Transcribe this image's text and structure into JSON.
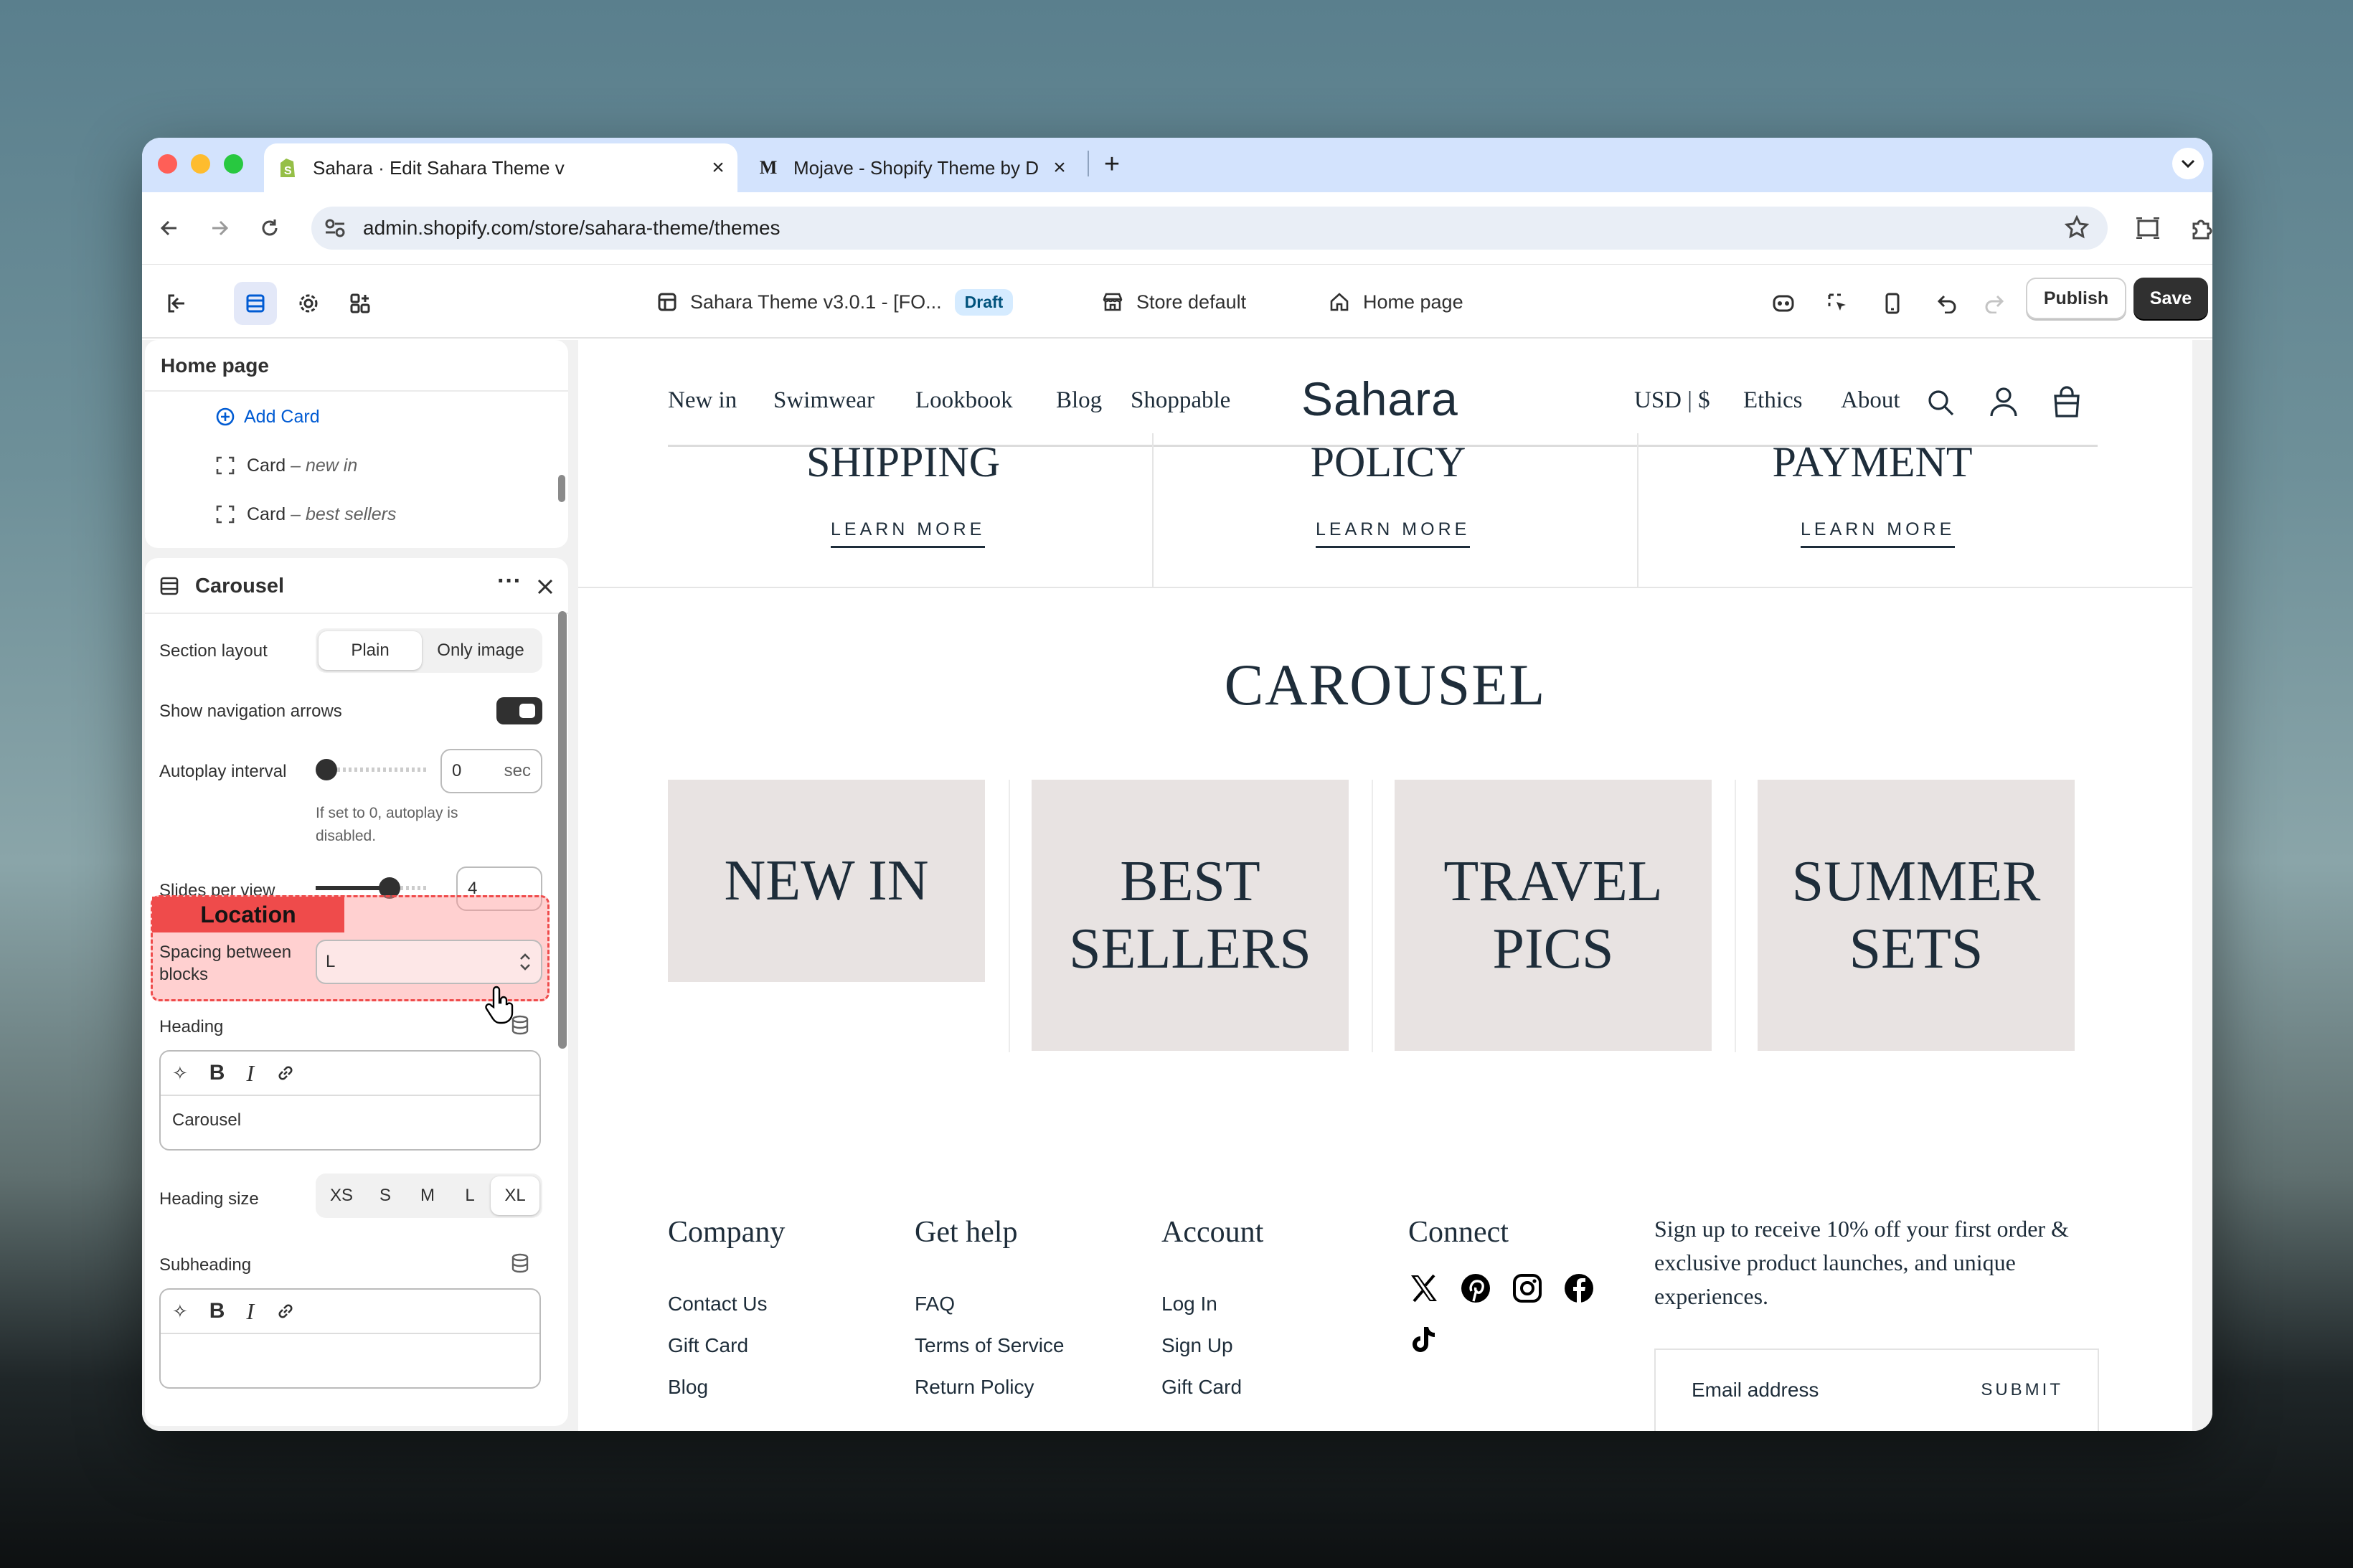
{
  "browser": {
    "tabs": [
      {
        "title": "Sahara · Edit Sahara Theme v",
        "favicon": "shopify-icon"
      },
      {
        "title": "Mojave - Shopify Theme by D",
        "favicon_letter": "M"
      }
    ],
    "url": "admin.shopify.com/store/sahara-theme/themes"
  },
  "app": {
    "theme_name": "Sahara Theme v3.0.1 - [FO...",
    "status_badge": "Draft",
    "store_selector": "Store default",
    "page_selector": "Home page",
    "publish_label": "Publish",
    "save_label": "Save"
  },
  "sidebar": {
    "header": "Home page",
    "add_card": "Add Card",
    "cards": [
      {
        "prefix": "Card",
        "name": "– new in"
      },
      {
        "prefix": "Card",
        "name": "– best sellers"
      }
    ]
  },
  "settings": {
    "title": "Carousel",
    "section_layout": {
      "label": "Section layout",
      "options": [
        "Plain",
        "Only image"
      ],
      "selected": "Plain"
    },
    "show_arrows": {
      "label": "Show navigation arrows",
      "value": true
    },
    "autoplay": {
      "label": "Autoplay interval",
      "value": "0",
      "unit": "sec",
      "help": "If set to 0, autoplay is disabled."
    },
    "slides_per_view": {
      "label": "Slides per view",
      "value": "4"
    },
    "tooltip": "Location",
    "spacing": {
      "label": "Spacing between blocks",
      "value": "L"
    },
    "heading": {
      "label": "Heading",
      "value": "Carousel"
    },
    "heading_size": {
      "label": "Heading size",
      "options": [
        "XS",
        "S",
        "M",
        "L",
        "XL"
      ],
      "selected": "XL"
    },
    "subheading": {
      "label": "Subheading",
      "value": ""
    }
  },
  "preview": {
    "nav_left": [
      "New in",
      "Swimwear",
      "Lookbook",
      "Blog",
      "Shoppable"
    ],
    "logo": "Sahara",
    "nav_right": [
      "USD | $",
      "Ethics",
      "About"
    ],
    "policies": [
      {
        "title": "SHIPPING",
        "link": "LEARN MORE"
      },
      {
        "title": "POLICY",
        "link": "LEARN MORE"
      },
      {
        "title": "PAYMENT",
        "link": "LEARN MORE"
      }
    ],
    "carousel_heading": "CAROUSEL",
    "cards": [
      "NEW IN",
      "BEST SELLERS",
      "TRAVEL PICS",
      "SUMMER SETS"
    ],
    "footer": {
      "columns": [
        {
          "title": "Company",
          "links": [
            "Contact Us",
            "Gift Card",
            "Blog"
          ]
        },
        {
          "title": "Get help",
          "links": [
            "FAQ",
            "Terms of Service",
            "Return Policy"
          ]
        },
        {
          "title": "Account",
          "links": [
            "Log In",
            "Sign Up",
            "Gift Card"
          ]
        }
      ],
      "connect_title": "Connect",
      "newsletter_text": "Sign up to receive 10% off your first order & exclusive product launches, and unique experiences.",
      "email_placeholder": "Email address",
      "submit_label": "SUBMIT"
    }
  },
  "colors": {
    "accent": "#005bd3",
    "ink": "#1e2d3a",
    "card_bg": "#e8e3e2",
    "tooltip": "#ef4b4b"
  }
}
